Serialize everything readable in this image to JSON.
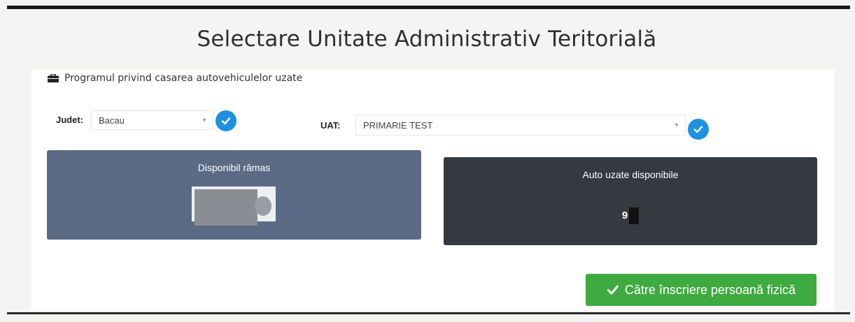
{
  "page": {
    "title": "Selectare Unitate Administrativ Teritorială"
  },
  "card": {
    "header_icon": "briefcase-icon",
    "header_text": "Programul privind casarea autovehiculelor uzate"
  },
  "filters": {
    "judet_label": "Judet:",
    "judet_value": "Bacau",
    "uat_label": "UAT:",
    "uat_value": "PRIMARIE TEST"
  },
  "panels": {
    "left": {
      "title": "Disponibil rămas",
      "color": "#5b6b85"
    },
    "right": {
      "title": "Auto uzate disponibile",
      "value_visible": "9",
      "color": "#343a40"
    }
  },
  "cta": {
    "label": "Către înscriere persoană fizică",
    "color": "#3faa3f"
  },
  "colors": {
    "confirm_button": "#1e90e0"
  }
}
